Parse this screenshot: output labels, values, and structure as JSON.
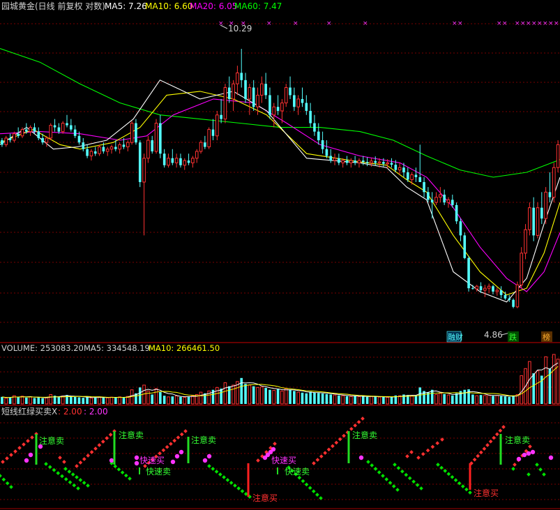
{
  "colors": {
    "up": "#ff3232",
    "down": "#54ffff",
    "ma5": "#ffffff",
    "ma10": "#ffff00",
    "ma20": "#ff00ff",
    "ma60": "#00ff00",
    "grid": "#7a0000",
    "divider": "#a00000",
    "text": "#d0d0d0",
    "dot_green": "#00e000",
    "dot_red": "#ff3030",
    "dot_magenta": "#ff33ff"
  },
  "price_panel": {
    "title": "园城黄金(日线 前复权 对数)",
    "legend": [
      {
        "label": "MA5: 7.26",
        "color_key": "ma5"
      },
      {
        "label": "MA10: 6.60",
        "color_key": "ma10"
      },
      {
        "label": "MA20: 6.05",
        "color_key": "ma20"
      },
      {
        "label": "MA60: 7.47",
        "color_key": "ma60"
      }
    ],
    "high_label": "10.29",
    "low_label": "4.86",
    "badges": [
      "融财",
      "跌",
      "榜"
    ]
  },
  "volume_panel": {
    "legend": [
      {
        "label": "VOLUME: 253083.20",
        "color_key": "text"
      },
      {
        "label": "MA5: 334548.19",
        "color_key": "text"
      },
      {
        "label": "MA10: 266461.50",
        "color_key": "ma10"
      }
    ]
  },
  "indicator_panel": {
    "title": "短线红绿买卖X",
    "values": [
      {
        "label": ": 2.00",
        "color_key": "dot_red"
      },
      {
        "label": ": 2.00",
        "color_key": "dot_magenta"
      }
    ],
    "signal_sell": "注意卖",
    "signal_buy": "注意买",
    "signal_fast_buy": "快速买",
    "signal_fast_sell": "快速卖"
  },
  "chart_data": {
    "type": "candlestick",
    "scale": "log",
    "ylim": [
      4.5,
      11.2
    ],
    "candles": [
      [
        7.9,
        7.95,
        7.75,
        7.8
      ],
      [
        7.8,
        8.0,
        7.75,
        7.95
      ],
      [
        7.95,
        8.05,
        7.85,
        7.9
      ],
      [
        7.9,
        8.1,
        7.85,
        8.05
      ],
      [
        8.05,
        8.2,
        7.95,
        8.0
      ],
      [
        8.0,
        8.2,
        7.95,
        8.15
      ],
      [
        8.15,
        8.3,
        8.05,
        8.1
      ],
      [
        8.1,
        8.25,
        8.0,
        8.2
      ],
      [
        8.2,
        8.3,
        8.05,
        8.1
      ],
      [
        8.1,
        8.2,
        7.9,
        7.95
      ],
      [
        7.95,
        8.05,
        7.8,
        7.85
      ],
      [
        7.85,
        8.0,
        7.75,
        7.95
      ],
      [
        7.95,
        8.3,
        7.9,
        8.25
      ],
      [
        8.25,
        8.4,
        8.1,
        8.2
      ],
      [
        8.2,
        8.3,
        8.05,
        8.1
      ],
      [
        8.1,
        8.35,
        8.05,
        8.3
      ],
      [
        8.3,
        8.5,
        8.2,
        8.25
      ],
      [
        8.25,
        8.4,
        8.1,
        8.15
      ],
      [
        8.15,
        8.25,
        7.95,
        8.0
      ],
      [
        8.0,
        8.1,
        7.8,
        7.85
      ],
      [
        7.85,
        7.95,
        7.65,
        7.7
      ],
      [
        7.7,
        7.8,
        7.5,
        7.55
      ],
      [
        7.55,
        7.7,
        7.45,
        7.65
      ],
      [
        7.65,
        7.75,
        7.55,
        7.6
      ],
      [
        7.6,
        7.8,
        7.55,
        7.75
      ],
      [
        7.75,
        7.85,
        7.6,
        7.65
      ],
      [
        7.65,
        7.75,
        7.55,
        7.7
      ],
      [
        7.7,
        7.8,
        7.6,
        7.75
      ],
      [
        7.75,
        7.9,
        7.65,
        7.7
      ],
      [
        7.7,
        7.85,
        7.6,
        7.8
      ],
      [
        7.8,
        7.95,
        7.7,
        7.75
      ],
      [
        7.75,
        7.9,
        7.65,
        7.85
      ],
      [
        7.85,
        8.35,
        7.8,
        8.3
      ],
      [
        8.3,
        8.4,
        7.8,
        7.85
      ],
      [
        7.85,
        7.9,
        6.9,
        7.0
      ],
      [
        7.0,
        7.6,
        6.0,
        7.5
      ],
      [
        7.5,
        8.0,
        7.4,
        7.9
      ],
      [
        7.9,
        8.0,
        7.6,
        7.65
      ],
      [
        7.65,
        8.4,
        7.6,
        8.3
      ],
      [
        8.3,
        8.5,
        7.5,
        7.6
      ],
      [
        7.6,
        7.7,
        7.3,
        7.35
      ],
      [
        7.35,
        7.6,
        7.3,
        7.5
      ],
      [
        7.5,
        7.7,
        7.35,
        7.4
      ],
      [
        7.4,
        7.6,
        7.3,
        7.5
      ],
      [
        7.5,
        7.6,
        7.3,
        7.35
      ],
      [
        7.35,
        7.5,
        7.25,
        7.45
      ],
      [
        7.45,
        7.6,
        7.35,
        7.4
      ],
      [
        7.4,
        7.55,
        7.3,
        7.5
      ],
      [
        7.5,
        7.7,
        7.4,
        7.65
      ],
      [
        7.65,
        7.9,
        7.6,
        7.85
      ],
      [
        7.85,
        8.0,
        7.7,
        7.75
      ],
      [
        7.75,
        8.2,
        7.7,
        8.15
      ],
      [
        8.15,
        8.4,
        7.9,
        8.0
      ],
      [
        8.0,
        8.6,
        7.9,
        8.5
      ],
      [
        8.5,
        8.9,
        8.3,
        8.4
      ],
      [
        8.4,
        9.3,
        8.3,
        9.2
      ],
      [
        9.2,
        9.5,
        8.8,
        8.9
      ],
      [
        8.9,
        9.4,
        8.6,
        9.3
      ],
      [
        9.3,
        9.8,
        9.0,
        9.6
      ],
      [
        9.6,
        10.29,
        9.2,
        9.4
      ],
      [
        9.4,
        9.6,
        8.8,
        8.9
      ],
      [
        8.9,
        9.3,
        8.5,
        9.2
      ],
      [
        9.2,
        9.4,
        8.6,
        8.7
      ],
      [
        8.7,
        9.2,
        8.5,
        9.0
      ],
      [
        9.0,
        9.5,
        8.8,
        9.3
      ],
      [
        9.3,
        9.6,
        8.9,
        9.0
      ],
      [
        9.0,
        9.2,
        8.4,
        8.5
      ],
      [
        8.5,
        8.8,
        8.2,
        8.7
      ],
      [
        8.7,
        9.0,
        8.5,
        8.6
      ],
      [
        8.6,
        8.9,
        8.3,
        8.8
      ],
      [
        8.8,
        9.3,
        8.7,
        9.2
      ],
      [
        9.2,
        9.5,
        8.9,
        9.0
      ],
      [
        9.0,
        9.2,
        8.6,
        8.7
      ],
      [
        8.7,
        9.0,
        8.5,
        8.9
      ],
      [
        8.9,
        9.2,
        8.7,
        8.8
      ],
      [
        8.8,
        9.0,
        8.5,
        8.6
      ],
      [
        8.6,
        8.8,
        8.2,
        8.3
      ],
      [
        8.3,
        8.5,
        8.0,
        8.1
      ],
      [
        8.1,
        8.3,
        7.8,
        7.9
      ],
      [
        7.9,
        8.1,
        7.6,
        7.7
      ],
      [
        7.7,
        7.9,
        7.5,
        7.55
      ],
      [
        7.55,
        7.7,
        7.4,
        7.45
      ],
      [
        7.45,
        7.6,
        7.35,
        7.5
      ],
      [
        7.5,
        7.6,
        7.35,
        7.4
      ],
      [
        7.4,
        7.5,
        7.3,
        7.45
      ],
      [
        7.45,
        7.55,
        7.35,
        7.4
      ],
      [
        7.4,
        7.5,
        7.3,
        7.45
      ],
      [
        7.45,
        7.55,
        7.35,
        7.4
      ],
      [
        7.4,
        7.5,
        7.3,
        7.45
      ],
      [
        7.45,
        7.55,
        7.35,
        7.42
      ],
      [
        7.42,
        7.52,
        7.33,
        7.4
      ],
      [
        7.4,
        7.5,
        7.32,
        7.44
      ],
      [
        7.44,
        7.54,
        7.34,
        7.4
      ],
      [
        7.4,
        7.5,
        7.3,
        7.42
      ],
      [
        7.42,
        7.5,
        7.32,
        7.38
      ],
      [
        7.38,
        7.48,
        7.28,
        7.4
      ],
      [
        7.4,
        7.5,
        7.3,
        7.36
      ],
      [
        7.36,
        7.46,
        7.2,
        7.25
      ],
      [
        7.25,
        7.4,
        7.15,
        7.3
      ],
      [
        7.3,
        7.4,
        7.1,
        7.2
      ],
      [
        7.2,
        7.3,
        7.0,
        7.05
      ],
      [
        7.05,
        7.2,
        6.95,
        7.15
      ],
      [
        7.15,
        7.3,
        7.0,
        7.1
      ],
      [
        7.1,
        7.8,
        7.0,
        7.0
      ],
      [
        7.0,
        7.1,
        6.7,
        6.8
      ],
      [
        6.8,
        6.9,
        6.6,
        6.65
      ],
      [
        6.65,
        6.8,
        6.3,
        6.6
      ],
      [
        6.6,
        6.8,
        6.55,
        6.7
      ],
      [
        6.7,
        6.9,
        6.6,
        6.75
      ],
      [
        6.75,
        6.85,
        6.55,
        6.6
      ],
      [
        6.6,
        6.7,
        6.5,
        6.65
      ],
      [
        6.65,
        6.75,
        6.5,
        6.55
      ],
      [
        6.55,
        6.6,
        6.2,
        6.25
      ],
      [
        6.25,
        6.3,
        5.9,
        6.0
      ],
      [
        6.0,
        6.05,
        5.6,
        5.62
      ],
      [
        5.62,
        5.65,
        5.1,
        5.15
      ],
      [
        5.15,
        5.2,
        5.13,
        5.14
      ],
      [
        5.14,
        5.2,
        5.1,
        5.18
      ],
      [
        5.18,
        5.24,
        5.08,
        5.12
      ],
      [
        5.12,
        5.2,
        5.02,
        5.15
      ],
      [
        5.15,
        5.22,
        5.08,
        5.18
      ],
      [
        5.18,
        5.2,
        5.06,
        5.1
      ],
      [
        5.1,
        5.16,
        5.04,
        5.12
      ],
      [
        5.12,
        5.18,
        5.0,
        5.05
      ],
      [
        5.05,
        5.1,
        4.98,
        5.0
      ],
      [
        5.0,
        5.05,
        4.95,
        4.98
      ],
      [
        4.98,
        5.0,
        4.86,
        4.88
      ],
      [
        4.88,
        5.25,
        4.86,
        5.2
      ],
      [
        5.2,
        5.8,
        5.15,
        5.7
      ],
      [
        5.7,
        6.2,
        5.6,
        6.1
      ],
      [
        6.1,
        6.6,
        6.0,
        6.5
      ],
      [
        6.5,
        6.7,
        5.9,
        6.0
      ],
      [
        6.0,
        6.6,
        5.95,
        6.5
      ],
      [
        6.5,
        6.8,
        6.2,
        6.3
      ],
      [
        6.3,
        6.9,
        6.2,
        6.8
      ],
      [
        6.8,
        7.2,
        6.6,
        6.7
      ],
      [
        6.7,
        7.4,
        6.6,
        7.3
      ],
      [
        7.3,
        7.9,
        7.2,
        7.8
      ]
    ],
    "volume": [
      30,
      25,
      28,
      35,
      30,
      33,
      27,
      30,
      25,
      28,
      24,
      26,
      40,
      35,
      30,
      34,
      38,
      32,
      30,
      28,
      26,
      30,
      25,
      28,
      30,
      27,
      26,
      29,
      28,
      30,
      27,
      32,
      60,
      45,
      70,
      80,
      55,
      40,
      65,
      50,
      35,
      30,
      32,
      34,
      30,
      28,
      32,
      34,
      40,
      50,
      45,
      55,
      60,
      70,
      65,
      90,
      75,
      80,
      95,
      110,
      85,
      80,
      75,
      70,
      72,
      68,
      60,
      58,
      62,
      55,
      65,
      60,
      55,
      50,
      48,
      45,
      52,
      48,
      46,
      44,
      42,
      40,
      38,
      36,
      35,
      33,
      32,
      34,
      31,
      33,
      30,
      32,
      31,
      29,
      30,
      28,
      30,
      36,
      35,
      40,
      38,
      35,
      36,
      70,
      55,
      50,
      60,
      40,
      45,
      42,
      38,
      36,
      45,
      55,
      60,
      62,
      40,
      35,
      38,
      36,
      38,
      34,
      36,
      33,
      32,
      30,
      34,
      40,
      120,
      150,
      180,
      130,
      140,
      120,
      200,
      150,
      210,
      190
    ],
    "ma_lines": [
      {
        "name": "MA5",
        "color_key": "ma5",
        "pts": [
          [
            7.8,
            0
          ],
          [
            8.2,
            20
          ],
          [
            7.7,
            40
          ],
          [
            7.75,
            58
          ],
          [
            7.9,
            80
          ],
          [
            8.4,
            100
          ],
          [
            9.4,
            120
          ],
          [
            8.9,
            150
          ],
          [
            9.1,
            175
          ],
          [
            8.6,
            200
          ],
          [
            7.5,
            230
          ],
          [
            7.4,
            270
          ],
          [
            7.3,
            290
          ],
          [
            6.9,
            305
          ],
          [
            6.65,
            320
          ],
          [
            5.4,
            340
          ],
          [
            5.1,
            360
          ],
          [
            4.95,
            380
          ],
          [
            5.3,
            395
          ],
          [
            6.2,
            408
          ],
          [
            7.1,
            420
          ]
        ]
      },
      {
        "name": "MA10",
        "color_key": "ma10",
        "pts": [
          [
            7.85,
            0
          ],
          [
            8.15,
            25
          ],
          [
            7.8,
            45
          ],
          [
            7.7,
            60
          ],
          [
            7.85,
            85
          ],
          [
            8.2,
            105
          ],
          [
            9.0,
            125
          ],
          [
            9.1,
            150
          ],
          [
            8.9,
            175
          ],
          [
            8.5,
            200
          ],
          [
            7.6,
            230
          ],
          [
            7.42,
            270
          ],
          [
            7.35,
            290
          ],
          [
            7.05,
            305
          ],
          [
            6.8,
            320
          ],
          [
            6.0,
            340
          ],
          [
            5.4,
            360
          ],
          [
            5.05,
            380
          ],
          [
            5.15,
            395
          ],
          [
            5.7,
            408
          ],
          [
            6.6,
            420
          ]
        ]
      },
      {
        "name": "MA20",
        "color_key": "ma20",
        "pts": [
          [
            8.05,
            0
          ],
          [
            8.1,
            30
          ],
          [
            8.05,
            60
          ],
          [
            7.9,
            90
          ],
          [
            8.0,
            110
          ],
          [
            8.5,
            130
          ],
          [
            8.9,
            160
          ],
          [
            8.8,
            190
          ],
          [
            8.3,
            215
          ],
          [
            7.8,
            240
          ],
          [
            7.55,
            270
          ],
          [
            7.4,
            300
          ],
          [
            7.1,
            320
          ],
          [
            6.5,
            340
          ],
          [
            5.8,
            360
          ],
          [
            5.3,
            380
          ],
          [
            5.1,
            395
          ],
          [
            5.4,
            408
          ],
          [
            6.05,
            420
          ]
        ]
      },
      {
        "name": "MA60",
        "color_key": "ma60",
        "pts": [
          [
            10.3,
            0
          ],
          [
            9.9,
            30
          ],
          [
            9.3,
            60
          ],
          [
            8.8,
            90
          ],
          [
            8.5,
            120
          ],
          [
            8.4,
            150
          ],
          [
            8.3,
            180
          ],
          [
            8.2,
            210
          ],
          [
            8.2,
            240
          ],
          [
            8.1,
            270
          ],
          [
            7.9,
            295
          ],
          [
            7.55,
            320
          ],
          [
            7.25,
            345
          ],
          [
            7.1,
            370
          ],
          [
            7.2,
            395
          ],
          [
            7.47,
            420
          ]
        ]
      }
    ]
  }
}
